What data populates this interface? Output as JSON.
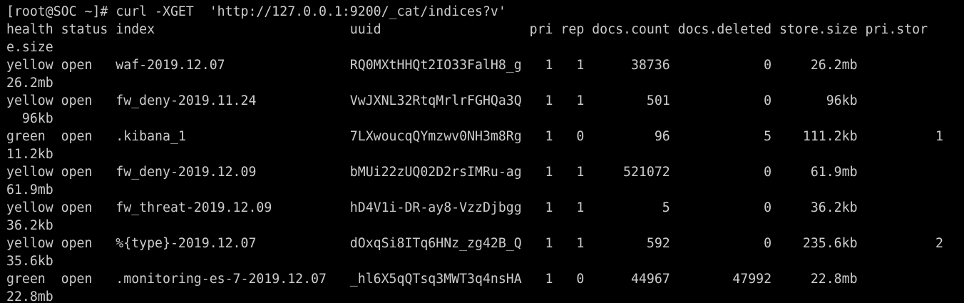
{
  "terminal": {
    "background": "#000000",
    "text_color": "#cccccc",
    "prompt": "[root@SOC ~]# ",
    "command": "curl -XGET  'http://127.0.0.1:9200/_cat/indices?v'",
    "header_line_1": "health status index                         uuid                   pri rep docs.count docs.deleted store.size pri.stor",
    "header_line_2": "e.size",
    "rows": [
      {
        "line": "yellow open   waf-2019.12.07                RQ0MXtHHQt2IO33FalH8_g   1   1      38736            0     26.2mb",
        "wrap": "26.2mb"
      },
      {
        "line": "yellow open   fw_deny-2019.11.24            VwJXNL32RtqMrlrFGHQa3Q   1   1        501            0       96kb",
        "wrap": "  96kb"
      },
      {
        "line": "green  open   .kibana_1                     7LXwoucqQYmzwv0NH3m8Rg   1   0         96            5    111.2kb          1",
        "wrap": "11.2kb"
      },
      {
        "line": "yellow open   fw_deny-2019.12.09            bMUi22zUQ02D2rsIMRu-ag   1   1     521072            0     61.9mb",
        "wrap": "61.9mb"
      },
      {
        "line": "yellow open   fw_threat-2019.12.09          hD4V1i-DR-ay8-VzzDjbgg   1   1          5            0     36.2kb",
        "wrap": "36.2kb"
      },
      {
        "line": "yellow open   %{type}-2019.12.07            dOxqSi8ITq6HNz_zg42B_Q   1   1        592            0    235.6kb          2",
        "wrap": "35.6kb"
      },
      {
        "line": "green  open   .monitoring-es-7-2019.12.07   _hl6X5qQTsq3MWT3q4nsHA   1   0      44967        47992     22.8mb",
        "wrap": "22.8mb"
      }
    ]
  }
}
